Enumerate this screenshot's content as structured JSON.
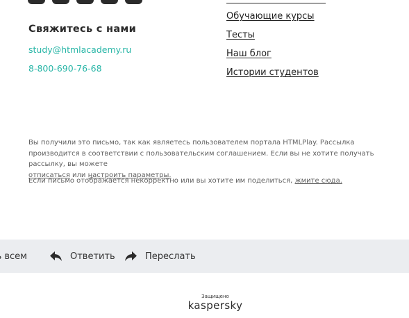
{
  "social": {
    "icons": [
      "social-icon",
      "social-icon",
      "social-icon",
      "social-icon",
      "social-icon"
    ]
  },
  "contact": {
    "title": "Свяжитесь с нами",
    "email": "study@htmlacademy.ru",
    "phone": "8-800-690-76-68"
  },
  "menu": {
    "items": [
      "Обучающие курсы",
      "Тесты",
      "Наш блог",
      "Истории студентов"
    ]
  },
  "notice": {
    "line1": "Вы получили это письмо, так как являетесь пользователем портала HTMLPlay. Рассылка производится в соответствии с пользовательским соглашением. Если вы не хотите получать рассылку, вы можете",
    "unsubscribe": "отписаться",
    "or": "или",
    "settings": "настроить параметры.",
    "line2": "Если письмо отображается некорректно или вы хотите им поделиться,",
    "click_here": "жмите сюда."
  },
  "actions": {
    "reply_all": "ть всем",
    "reply": "Ответить",
    "forward": "Переслать"
  },
  "footer": {
    "protected": "Защищено",
    "brand": "kaspersky"
  },
  "colors": {
    "accent": "#26b5a6",
    "bar": "#ebedf0",
    "text": "#2b2b2b"
  }
}
